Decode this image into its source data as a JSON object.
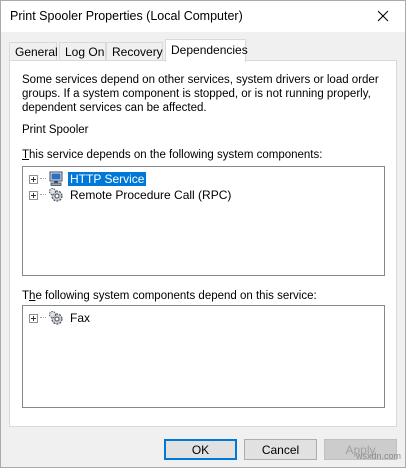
{
  "window": {
    "title": "Print Spooler Properties (Local Computer)"
  },
  "tabs": [
    {
      "label": "General"
    },
    {
      "label": "Log On"
    },
    {
      "label": "Recovery"
    },
    {
      "label": "Dependencies"
    }
  ],
  "dependencies": {
    "description": "Some services depend on other services, system drivers or load order groups. If a system component is stopped, or is not running properly, dependent services can be affected.",
    "service_name": "Print Spooler",
    "depends_on_label_first": "T",
    "depends_on_label_rest": "his service depends on the following system components:",
    "depends_on_items": [
      {
        "label": "HTTP Service",
        "icon": "computer-icon",
        "selected": true
      },
      {
        "label": "Remote Procedure Call (RPC)",
        "icon": "gear-icon",
        "selected": false
      }
    ],
    "dependents_label_pre": "T",
    "dependents_label_u": "h",
    "dependents_label_rest": "e following system components depend on this service:",
    "dependents_items": [
      {
        "label": "Fax",
        "icon": "gear-icon",
        "selected": false
      }
    ]
  },
  "buttons": {
    "ok": "OK",
    "cancel": "Cancel",
    "apply": "Apply"
  },
  "watermark": "wsxdn.com"
}
